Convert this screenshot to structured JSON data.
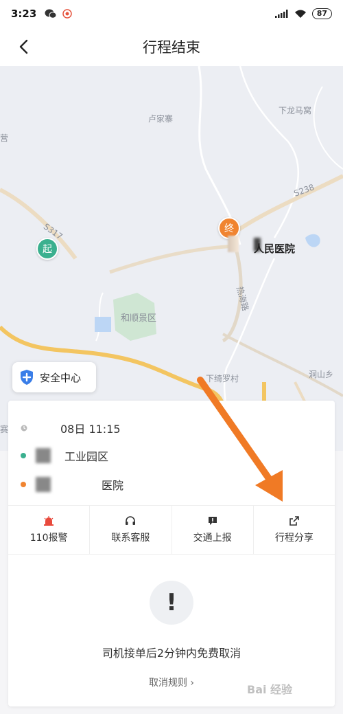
{
  "status_bar": {
    "time": "3:23",
    "battery": "87"
  },
  "header": {
    "title": "行程结束"
  },
  "map": {
    "labels": [
      "卢家寨",
      "下龙马窝",
      "S238",
      "S317",
      "和顺景区",
      "热海路",
      "下绮罗村",
      "洞山乡",
      "营",
      "赛"
    ],
    "start_pin": "起",
    "end_pin": "终",
    "poi": "人民医院"
  },
  "safety": {
    "label": "安全中心"
  },
  "trip": {
    "time": "08日 11:15",
    "from": "工业园区",
    "to": "医院"
  },
  "actions": [
    {
      "label": "110报警",
      "icon": "alarm-icon"
    },
    {
      "label": "联系客服",
      "icon": "headset-icon"
    },
    {
      "label": "交通上报",
      "icon": "report-icon"
    },
    {
      "label": "行程分享",
      "icon": "share-icon"
    }
  ],
  "cancel": {
    "notice": "司机接单后2分钟内免费取消",
    "rules_link": "取消规则 ›"
  },
  "colors": {
    "start": "#3bb08f",
    "end": "#f08430",
    "arrow": "#f07a25"
  },
  "watermark": "Bai 经验"
}
